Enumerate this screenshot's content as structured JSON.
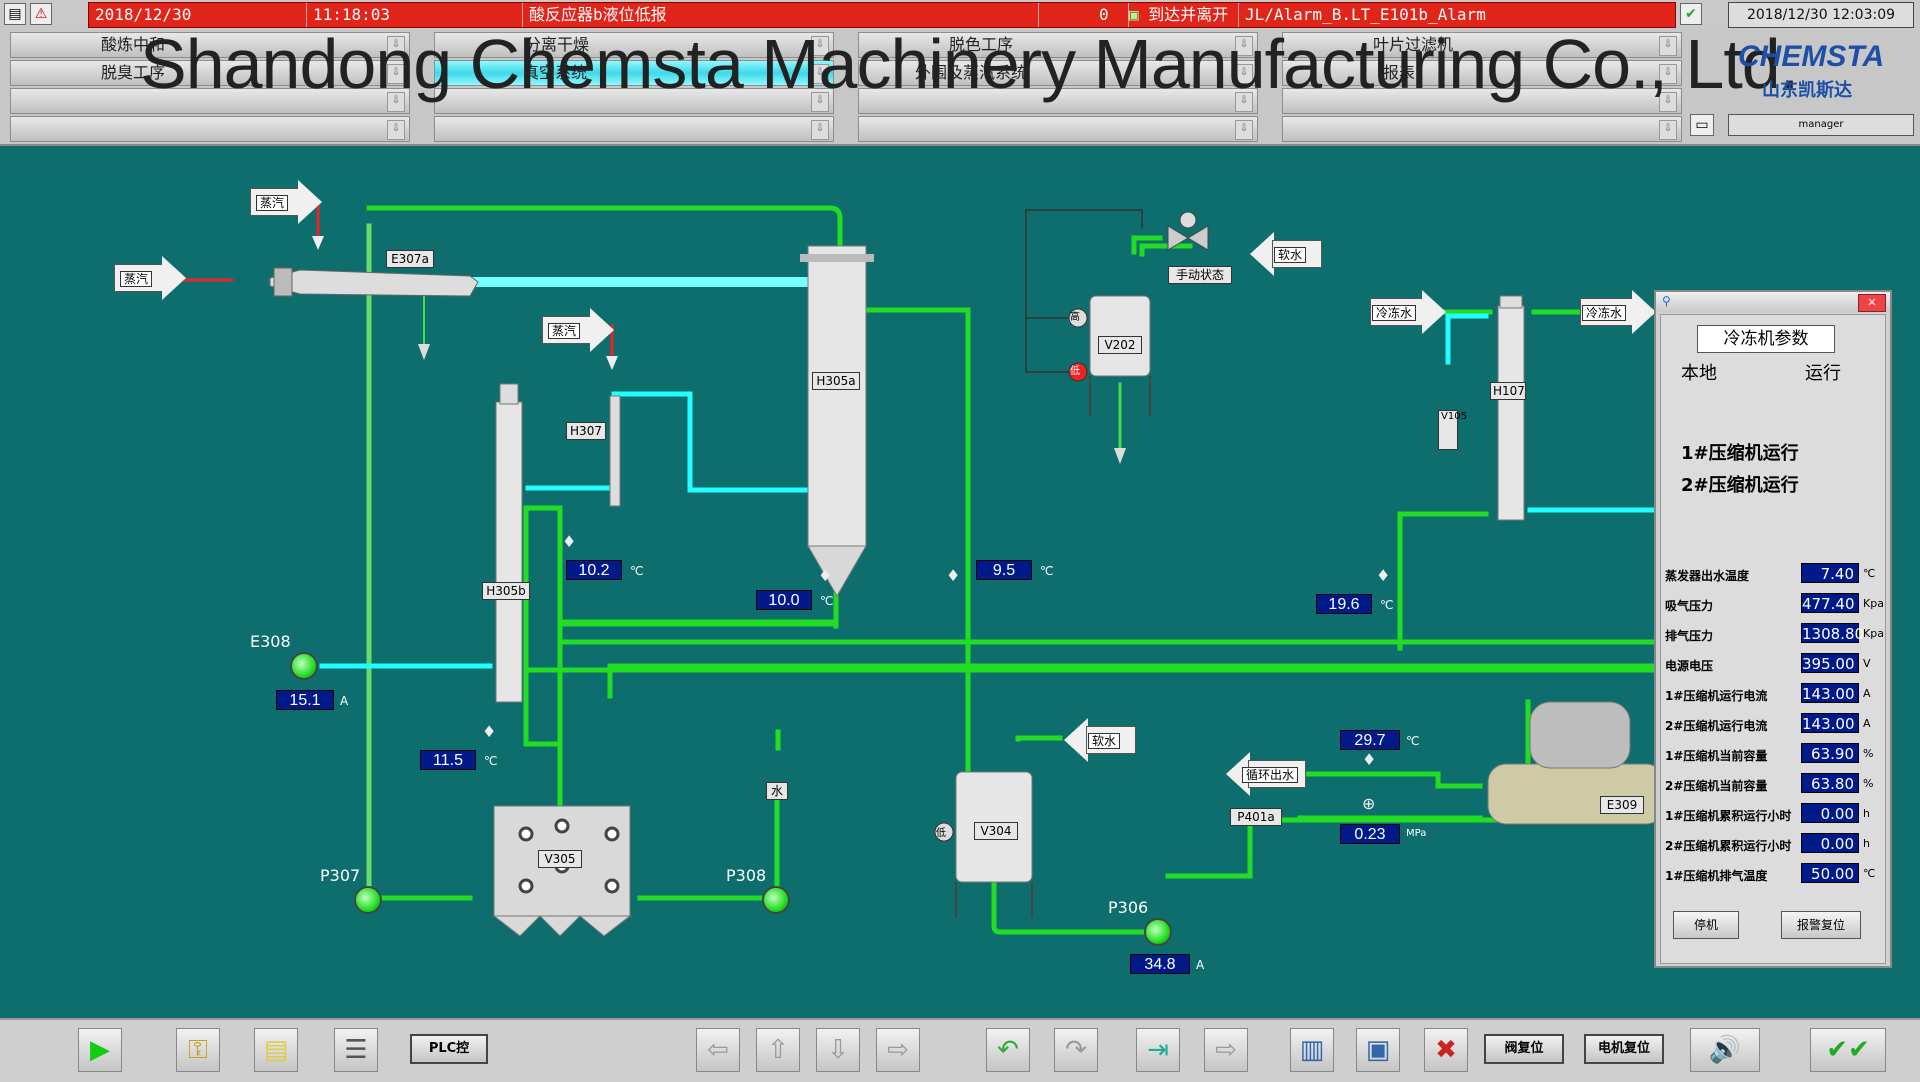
{
  "alarm_bar": {
    "date": "2018/12/30",
    "time": "11:18:03",
    "message": "酸反应器b液位低报",
    "count": "0",
    "status": "到达并离开",
    "tag": "JL/Alarm_B.LT_E101b_Alarm",
    "clock": "2018/12/30 12:03:09"
  },
  "nav": {
    "row1": [
      "酸炼中和",
      "分离干燥",
      "脱色工序",
      "叶片过滤机"
    ],
    "row2": [
      "脱臭工序",
      "真空系统",
      "外围及蒸汽系统",
      "报表"
    ],
    "active": "真空系统"
  },
  "watermark": "Shandong Chemsta Machinery Manufacturing Co., Ltd.",
  "logo": {
    "brand": "CHEMSTA",
    "cn": "山东凯斯达"
  },
  "user": "manager",
  "tags": {
    "e307a": "E307a",
    "h307": "H307",
    "h305a": "H305a",
    "h305b": "H305b",
    "v202": "V202",
    "manual_state": "手动状态",
    "h107": "H107",
    "v105": "V105",
    "v305": "V305",
    "v304": "V304",
    "e309": "E309",
    "p401a": "P401a",
    "water": "水"
  },
  "arrow_labels": {
    "steam": "蒸汽",
    "soft_water": "软水",
    "chilled_water": "冷冻水",
    "circ_out": "循环出水"
  },
  "levels": {
    "high": "高",
    "low": "低"
  },
  "pumps": {
    "e308": "E308",
    "p307": "P307",
    "p308": "P308",
    "p306": "P306"
  },
  "values": {
    "t1": "10.2",
    "t2": "10.0",
    "t3": "9.5",
    "t4": "19.6",
    "t5": "15.1",
    "t6": "11.5",
    "t7": "29.7",
    "t8": "0.23",
    "t9": "34.8"
  },
  "units": {
    "degc": "℃",
    "amp": "A",
    "mpa": "MPa"
  },
  "panel": {
    "title": "冷冻机参数",
    "mode": "本地",
    "state": "运行",
    "comp1": "1#压缩机运行",
    "comp2": "2#压缩机运行",
    "rows": [
      {
        "name": "蒸发器出水温度",
        "value": "7.40",
        "unit": "℃"
      },
      {
        "name": "吸气压力",
        "value": "477.40",
        "unit": "Kpa"
      },
      {
        "name": "排气压力",
        "value": "1308.80",
        "unit": "Kpa"
      },
      {
        "name": "电源电压",
        "value": "395.00",
        "unit": "V"
      },
      {
        "name": "1#压缩机运行电流",
        "value": "143.00",
        "unit": "A"
      },
      {
        "name": "2#压缩机运行电流",
        "value": "143.00",
        "unit": "A"
      },
      {
        "name": "1#压缩机当前容量",
        "value": "63.90",
        "unit": "%"
      },
      {
        "name": "2#压缩机当前容量",
        "value": "63.80",
        "unit": "%"
      },
      {
        "name": "1#压缩机累积运行小时",
        "value": "0.00",
        "unit": "h"
      },
      {
        "name": "2#压缩机累积运行小时",
        "value": "0.00",
        "unit": "h"
      },
      {
        "name": "1#压缩机排气温度",
        "value": "50.00",
        "unit": "℃"
      }
    ],
    "stop": "停机",
    "reset": "报警复位"
  },
  "toolbar": {
    "plc": "PLC控",
    "valve_reset": "阀复位",
    "motor_reset": "电机复位"
  }
}
